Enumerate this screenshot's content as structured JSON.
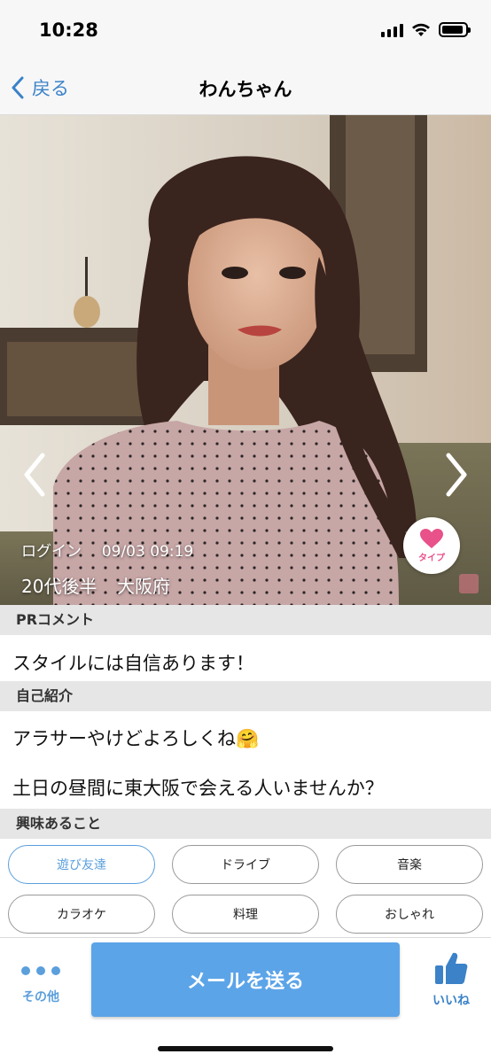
{
  "status_bar": {
    "time": "10:28",
    "battery_level": 0.9
  },
  "nav": {
    "back_label": "戻る",
    "title": "わんちゃん"
  },
  "photo": {
    "login_label": "ログイン",
    "login_datetime": "09/03 09:19",
    "age": "20代後半",
    "location": "大阪府",
    "type_button_label": "タイプ",
    "icons": {
      "prev": "chevron-left-icon",
      "next": "chevron-right-icon",
      "type": "heart-icon"
    }
  },
  "pr_comment": {
    "header": "PRコメント",
    "text": "スタイルには自信あります！"
  },
  "self_intro": {
    "header": "自己紹介",
    "line1": "アラサーやけどよろしくね🤗",
    "line2": "土日の昼間に東大阪で会える人いませんか？"
  },
  "interests": {
    "header": "興味あること",
    "tags": [
      {
        "label": "遊び友達",
        "active": true
      },
      {
        "label": "ドライブ",
        "active": false
      },
      {
        "label": "音楽",
        "active": false
      },
      {
        "label": "カラオケ",
        "active": false
      },
      {
        "label": "料理",
        "active": false
      },
      {
        "label": "おしゃれ",
        "active": false
      }
    ]
  },
  "bottom_bar": {
    "more_label": "その他",
    "send_label": "メールを送る",
    "like_label": "いいね",
    "icons": {
      "more": "more-dots-icon",
      "like": "thumbs-up-icon"
    }
  },
  "colors": {
    "accent": "#5ca4e8",
    "link": "#3b82c8",
    "heart": "#e8518a",
    "section_bg": "#e6e6e6"
  }
}
